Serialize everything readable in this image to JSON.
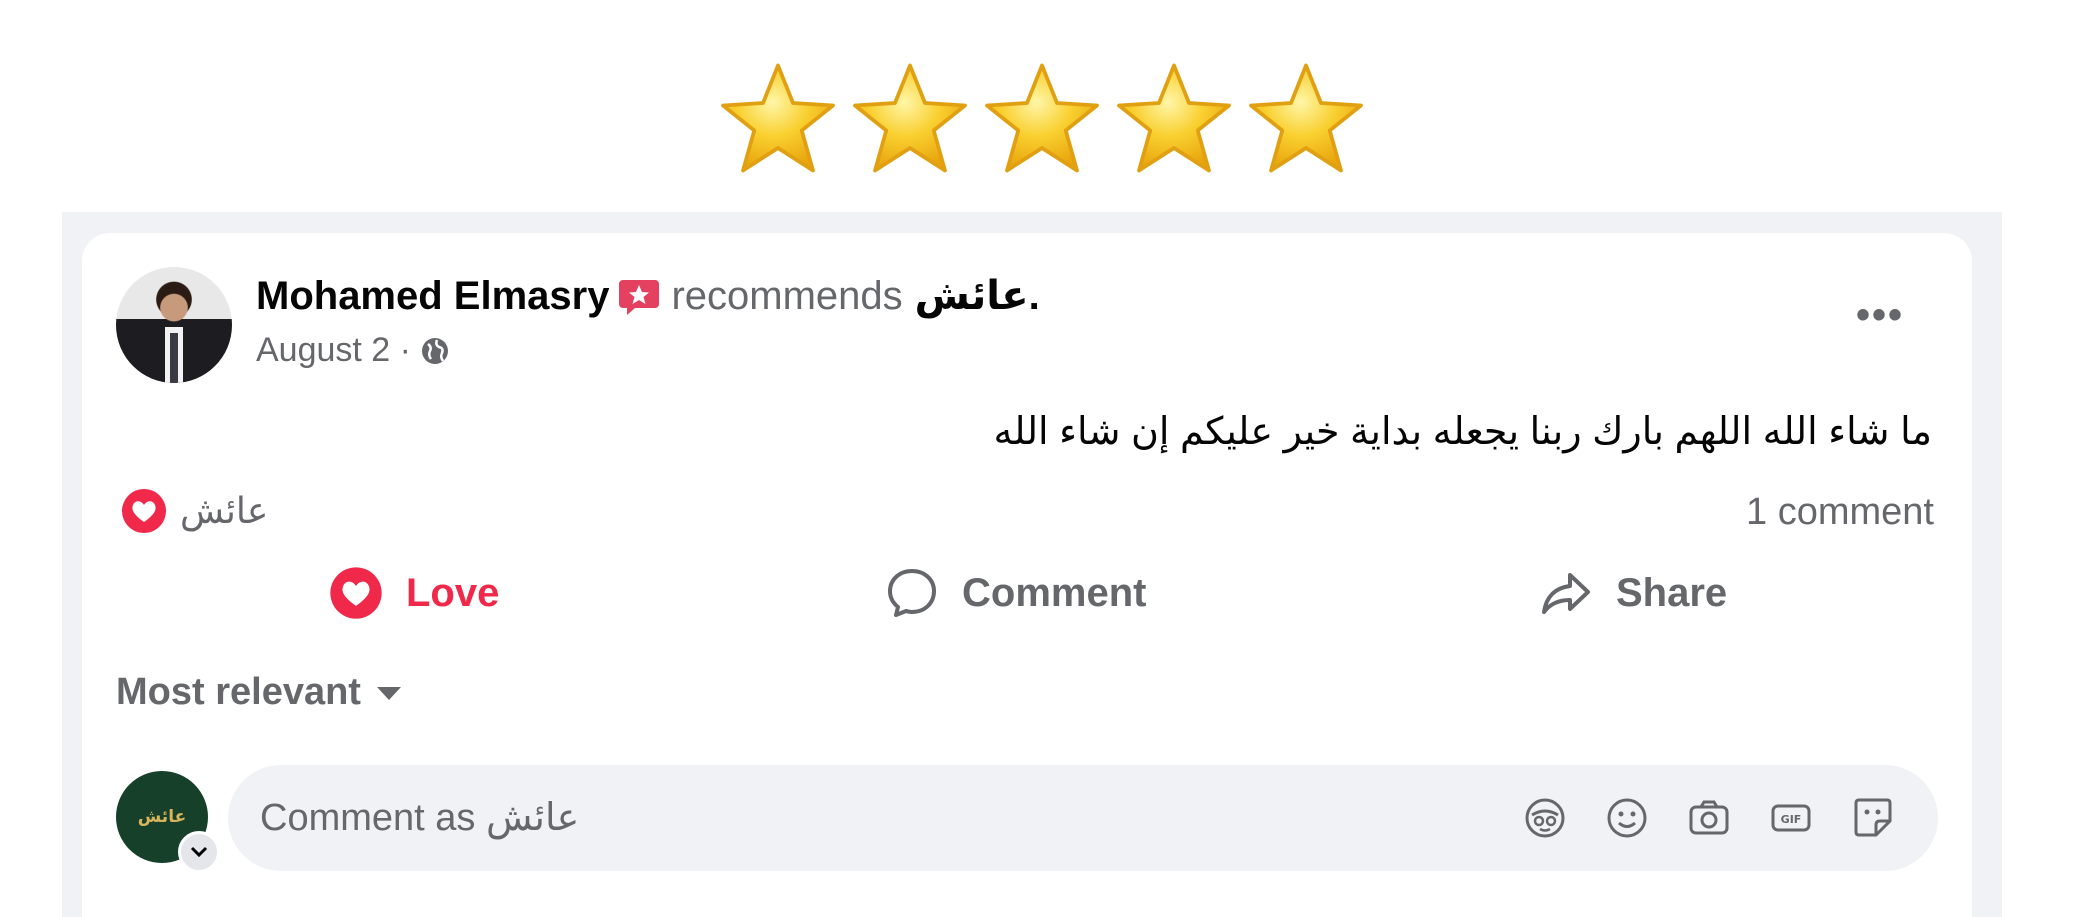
{
  "rating": {
    "stars": 5,
    "max": 5,
    "color": "#f7c41f"
  },
  "post": {
    "author": "Mohamed Elmasry",
    "recommends_label": "recommends",
    "page_name": "عائش.",
    "date": "August 2 ·",
    "text": "ما شاء الله اللهم بارك ربنا يجعله بداية خير عليكم إن شاء الله",
    "reactor_name": "عائش",
    "comment_count": "1 comment",
    "more_label": "•••"
  },
  "actions": {
    "love": "Love",
    "comment": "Comment",
    "share": "Share"
  },
  "comments": {
    "sort_label": "Most relevant",
    "placeholder": "Comment as عائش",
    "avatar_text": "عائش"
  },
  "colors": {
    "love": "#f02849",
    "secondary_text": "#65676b",
    "badge": "#e4405f"
  },
  "icons": [
    "star-icon",
    "recommend-badge-icon",
    "globe-icon",
    "more-icon",
    "love-icon",
    "comment-icon",
    "share-icon",
    "caret-down-icon",
    "avatar-sticker-icon",
    "emoji-icon",
    "camera-icon",
    "gif-icon",
    "sticker-icon"
  ]
}
